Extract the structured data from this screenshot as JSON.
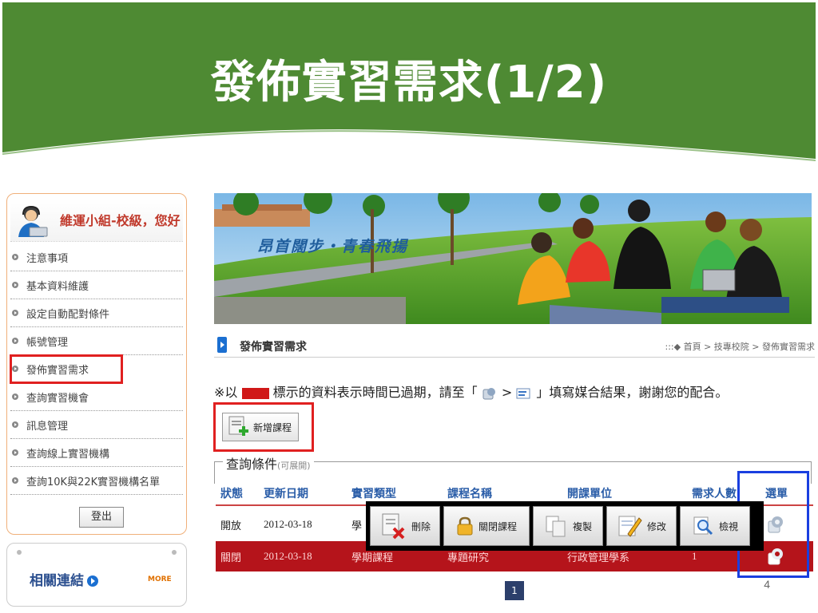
{
  "slide": {
    "title": "發佈實習需求(1/2)",
    "page_number": "4"
  },
  "sidebar": {
    "user_greeting": "維運小組-校級，您好",
    "items": [
      {
        "label": "注意事項"
      },
      {
        "label": "基本資料維護"
      },
      {
        "label": "設定自動配對條件"
      },
      {
        "label": "帳號管理"
      },
      {
        "label": "發佈實習需求"
      },
      {
        "label": "查詢實習機會"
      },
      {
        "label": "訊息管理"
      },
      {
        "label": "查詢線上實習機構"
      },
      {
        "label": "查詢10K與22K實習機構名單"
      }
    ],
    "logout_label": "登出",
    "links_title": "相關連結",
    "more_label": "MORE"
  },
  "banner": {
    "slogan": "昂首闊步・青春飛揚"
  },
  "page": {
    "title": "發佈實習需求",
    "breadcrumb": ":::◆ 首頁 > 技專校院 > 發佈實習需求",
    "notice_before": "※以",
    "notice_middle": "標示的資料表示時間已過期，請至「",
    "notice_gt": ">",
    "notice_after": "」填寫媒合結果，謝謝您的配合。",
    "new_course_label": "新增課程",
    "query_legend": "查詢條件",
    "query_expand": "(可展開)"
  },
  "table": {
    "headers": [
      "狀態",
      "更新日期",
      "實習類型",
      "課程名稱",
      "開課單位",
      "需求人數",
      "選單"
    ],
    "rows": [
      {
        "status": "開放",
        "date": "2012-03-18",
        "type": "學",
        "name": "",
        "unit": "",
        "count": ""
      },
      {
        "status": "關閉",
        "date": "2012-03-18",
        "type": "學期課程",
        "name": "專題研究",
        "unit": "行政管理學系",
        "count": "1"
      }
    ],
    "page": "1"
  },
  "popup": {
    "buttons": [
      {
        "label": "刪除",
        "icon": "delete-icon"
      },
      {
        "label": "關閉課程",
        "icon": "lock-icon"
      },
      {
        "label": "複製",
        "icon": "copy-icon"
      },
      {
        "label": "修改",
        "icon": "edit-icon"
      },
      {
        "label": "檢視",
        "icon": "magnifier-icon"
      }
    ]
  },
  "colors": {
    "slide_green": "#4e8a33",
    "highlight_red": "#e02020",
    "highlight_blue": "#1a3fe0",
    "expired_row": "#b5141b",
    "header_blue": "#2a5da8"
  }
}
